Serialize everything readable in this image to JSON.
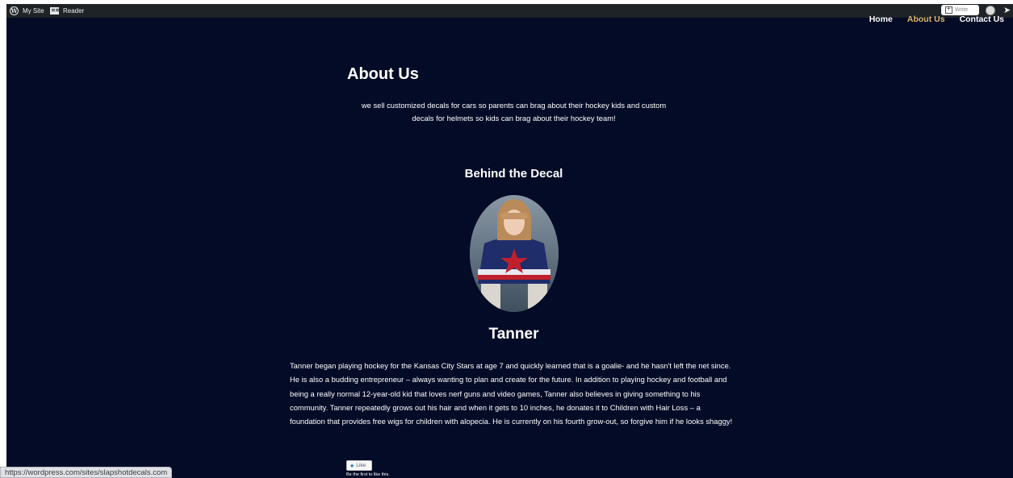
{
  "admin_bar": {
    "my_site": "My Site",
    "reader": "Reader",
    "write": "Write",
    "icons": [
      "wordpress-logo-icon",
      "reader-icon",
      "write-icon",
      "avatar-icon",
      "notification-icon"
    ]
  },
  "nav": {
    "items": [
      {
        "label": "Home",
        "active": false
      },
      {
        "label": "About Us",
        "active": true
      },
      {
        "label": "Contact Us",
        "active": false
      }
    ]
  },
  "page": {
    "title": "About Us",
    "intro": "we sell customized decals for cars so parents can brag about their hockey kids and custom decals for helmets so kids can brag about their hockey team!",
    "section_title": "Behind the Decal",
    "name": "Tanner",
    "bio": "Tanner began playing hockey for the Kansas City Stars at age 7 and quickly learned that is a goalie- and he hasn't left the net since. He is also a budding entrepreneur – always wanting to plan and create for the future. In addition to playing hockey and football and being a really normal 12-year-old kid that loves nerf guns and video games, Tanner also believes in giving something to his community. Tanner repeatedly grows out his hair and when it gets to 10 inches, he donates it to Children with Hair Loss – a foundation that provides free wigs for children with alopecia. He is currently on his fourth grow-out, so forgive him if he looks shaggy!"
  },
  "like": {
    "button": "Like",
    "text": "Be the first to like this."
  },
  "status_url": "https://wordpress.com/sites/slapshotdecals.com",
  "colors": {
    "background": "#030b26",
    "admin_bar": "#1d2327",
    "nav_active": "#e2b866",
    "text": "#ffffff"
  }
}
